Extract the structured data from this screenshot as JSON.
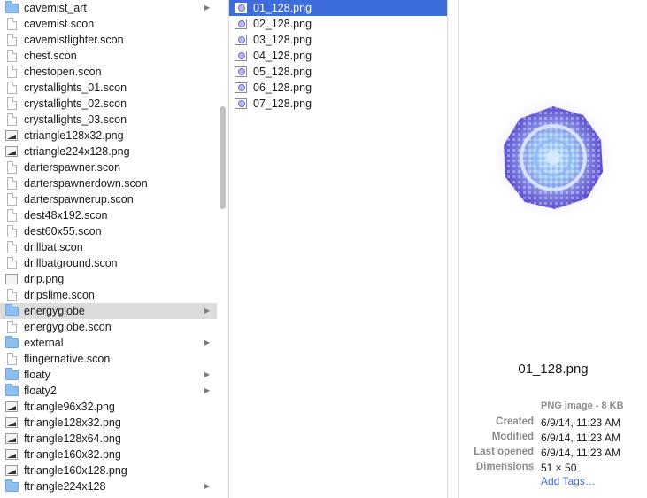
{
  "column1": {
    "items": [
      {
        "name": "cavemist_art",
        "kind": "folder"
      },
      {
        "name": "cavemist.scon",
        "kind": "file"
      },
      {
        "name": "cavemistlighter.scon",
        "kind": "file"
      },
      {
        "name": "chest.scon",
        "kind": "file"
      },
      {
        "name": "chestopen.scon",
        "kind": "file"
      },
      {
        "name": "crystallights_01.scon",
        "kind": "file"
      },
      {
        "name": "crystallights_02.scon",
        "kind": "file"
      },
      {
        "name": "crystallights_03.scon",
        "kind": "file"
      },
      {
        "name": "ctriangle128x32.png",
        "kind": "png-triangle"
      },
      {
        "name": "ctriangle224x128.png",
        "kind": "png-triangle"
      },
      {
        "name": "darterspawner.scon",
        "kind": "file"
      },
      {
        "name": "darterspawnerdown.scon",
        "kind": "file"
      },
      {
        "name": "darterspawnerup.scon",
        "kind": "file"
      },
      {
        "name": "dest48x192.scon",
        "kind": "file"
      },
      {
        "name": "dest60x55.scon",
        "kind": "file"
      },
      {
        "name": "drillbat.scon",
        "kind": "file"
      },
      {
        "name": "drillbatground.scon",
        "kind": "file"
      },
      {
        "name": "drip.png",
        "kind": "png"
      },
      {
        "name": "dripslime.scon",
        "kind": "file"
      },
      {
        "name": "energyglobe",
        "kind": "folder",
        "selected": true
      },
      {
        "name": "energyglobe.scon",
        "kind": "file"
      },
      {
        "name": "external",
        "kind": "folder"
      },
      {
        "name": "flingernative.scon",
        "kind": "file"
      },
      {
        "name": "floaty",
        "kind": "folder"
      },
      {
        "name": "floaty2",
        "kind": "folder"
      },
      {
        "name": "ftriangle96x32.png",
        "kind": "png-triangle"
      },
      {
        "name": "ftriangle128x32.png",
        "kind": "png-triangle"
      },
      {
        "name": "ftriangle128x64.png",
        "kind": "png-triangle"
      },
      {
        "name": "ftriangle160x32.png",
        "kind": "png-triangle"
      },
      {
        "name": "ftriangle160x128.png",
        "kind": "png-triangle"
      },
      {
        "name": "ftriangle224x128",
        "kind": "folder"
      }
    ]
  },
  "column2": {
    "items": [
      {
        "name": "01_128.png",
        "selected": true
      },
      {
        "name": "02_128.png"
      },
      {
        "name": "03_128.png"
      },
      {
        "name": "04_128.png"
      },
      {
        "name": "05_128.png"
      },
      {
        "name": "06_128.png"
      },
      {
        "name": "07_128.png"
      }
    ]
  },
  "preview": {
    "filename": "01_128.png",
    "kind": "PNG image - 8 KB",
    "created_label": "Created",
    "created": "6/9/14, 11:23 AM",
    "modified_label": "Modified",
    "modified": "6/9/14, 11:23 AM",
    "last_opened_label": "Last opened",
    "last_opened": "6/9/14, 11:23 AM",
    "dimensions_label": "Dimensions",
    "dimensions": "51 × 50",
    "add_tags": "Add Tags…"
  },
  "colors": {
    "selection_blue": "#3d6cdb",
    "selection_gray": "#dcdcdc",
    "folder": "#8ec0ef",
    "link": "#3d6cdb"
  }
}
